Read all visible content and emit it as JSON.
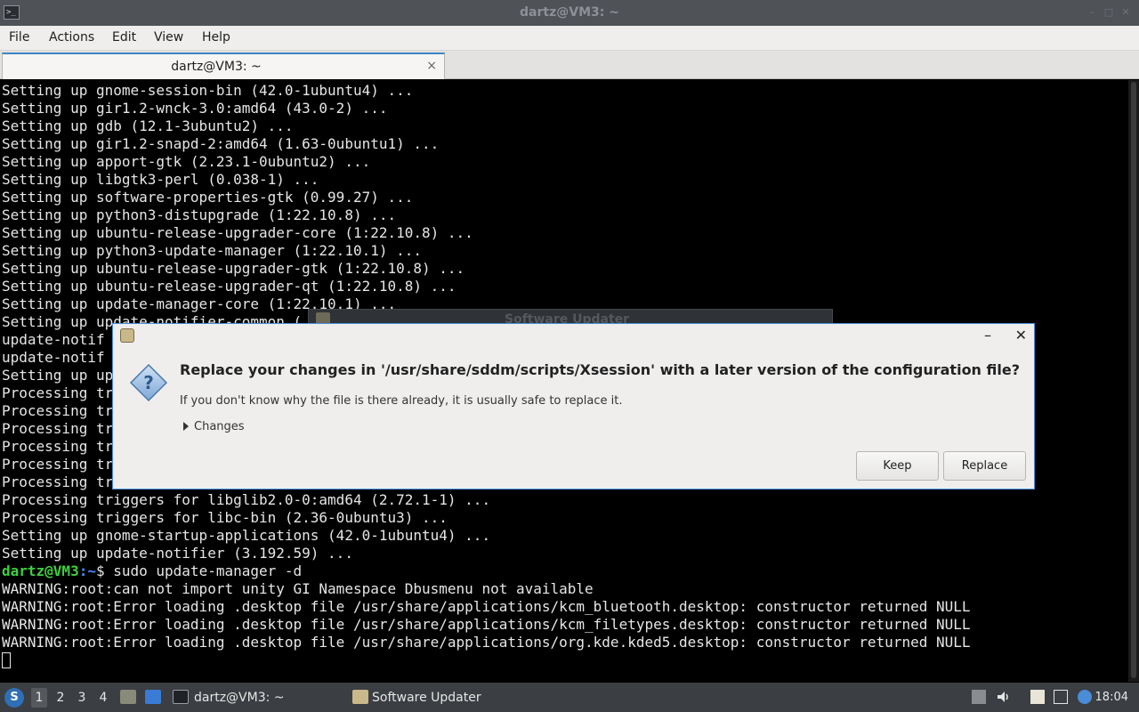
{
  "window": {
    "title": "dartz@VM3: ~",
    "controls": [
      "–",
      "□",
      "✕"
    ]
  },
  "menu": [
    "File",
    "Actions",
    "Edit",
    "View",
    "Help"
  ],
  "tab": {
    "label": "dartz@VM3: ~",
    "close": "×"
  },
  "terminal": {
    "lines": [
      "Setting up gnome-session-bin (42.0-1ubuntu4) ...",
      "Setting up gir1.2-wnck-3.0:amd64 (43.0-2) ...",
      "Setting up gdb (12.1-3ubuntu2) ...",
      "Setting up gir1.2-snapd-2:amd64 (1.63-0ubuntu1) ...",
      "Setting up apport-gtk (2.23.1-0ubuntu2) ...",
      "Setting up libgtk3-perl (0.038-1) ...",
      "Setting up software-properties-gtk (0.99.27) ...",
      "Setting up python3-distupgrade (1:22.10.8) ...",
      "Setting up ubuntu-release-upgrader-core (1:22.10.8) ...",
      "Setting up python3-update-manager (1:22.10.1) ...",
      "Setting up ubuntu-release-upgrader-gtk (1:22.10.8) ...",
      "Setting up ubuntu-release-upgrader-qt (1:22.10.8) ...",
      "Setting up update-manager-core (1:22.10.1) ...",
      "Setting up update-notifier-common (",
      "update-notif",
      "update-notif",
      "Setting up up",
      "Processing tr",
      "Processing tr",
      "Processing tr",
      "Processing tr",
      "Processing tr",
      "Processing tr",
      "Processing triggers for libglib2.0-0:amd64 (2.72.1-1) ...",
      "Processing triggers for libc-bin (2.36-0ubuntu3) ...",
      "Setting up gnome-startup-applications (42.0-1ubuntu4) ...",
      "Setting up update-notifier (3.192.59) ..."
    ],
    "prompt_user": "dartz@VM3",
    "prompt_path": ":~",
    "prompt_symbol": "$ ",
    "command": "sudo update-manager -d",
    "output": [
      "WARNING:root:can not import unity GI Namespace Dbusmenu not available",
      "WARNING:root:Error loading .desktop file /usr/share/applications/kcm_bluetooth.desktop: constructor returned NULL",
      "WARNING:root:Error loading .desktop file /usr/share/applications/kcm_filetypes.desktop: constructor returned NULL",
      "WARNING:root:Error loading .desktop file /usr/share/applications/org.kde.kded5.desktop: constructor returned NULL"
    ]
  },
  "background_window": {
    "title": "Software Updater"
  },
  "dialog": {
    "minimize": "–",
    "close": "✕",
    "heading": "Replace your changes in '/usr/share/sddm/scripts/Xsession' with a later version of the configuration file?",
    "body": "If you don't know why the file is there already, it is usually safe to replace it.",
    "expander": "Changes",
    "keep_label": "Keep",
    "replace_label": "Replace"
  },
  "taskbar": {
    "start": "S",
    "workspaces": [
      "1",
      "2",
      "3",
      "4"
    ],
    "tasks": [
      "dartz@VM3: ~",
      "Software Updater"
    ],
    "clock": "18:04"
  },
  "colors": {
    "terminal_bg": "#000000",
    "terminal_fg": "#e6e6e6",
    "prompt_user": "#3fcf3f",
    "prompt_path": "#4a8cff",
    "dialog_border": "#4a90d9",
    "taskbar_bg": "#3b3e42"
  }
}
